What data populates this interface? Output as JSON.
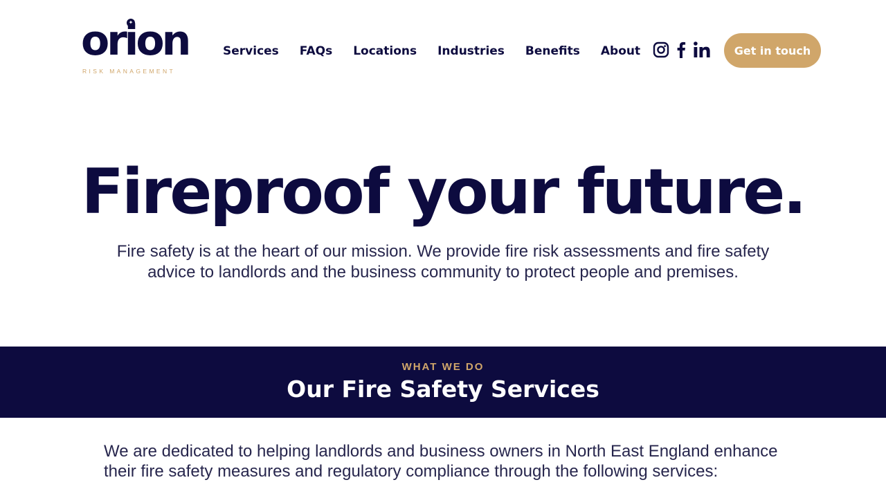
{
  "brand": {
    "name": "orion",
    "tagline": "RISK MANAGEMENT",
    "accent_color": "#d0a66a",
    "primary_color": "#0d0b3f"
  },
  "nav": {
    "items": [
      {
        "label": "Services"
      },
      {
        "label": "FAQs"
      },
      {
        "label": "Locations"
      },
      {
        "label": "Industries"
      },
      {
        "label": "Benefits"
      },
      {
        "label": "About"
      }
    ]
  },
  "social": {
    "icons": [
      "instagram-icon",
      "facebook-icon",
      "linkedin-icon"
    ]
  },
  "cta": {
    "label": "Get in touch"
  },
  "hero": {
    "title": "Fireproof your future.",
    "text": "Fire safety is at the heart of our mission. We provide fire risk assessments and fire safety advice to landlords and the business community to protect people and premises."
  },
  "services": {
    "eyebrow": "WHAT WE DO",
    "title": "Our Fire Safety Services",
    "intro": "We are dedicated to helping landlords and business owners in North East England enhance their fire safety measures and regulatory compliance through the following services:"
  }
}
